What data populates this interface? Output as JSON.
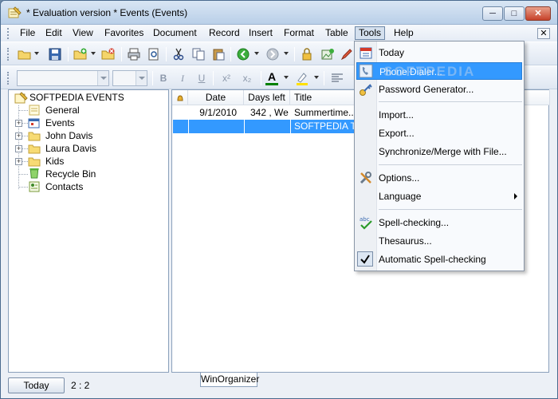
{
  "window": {
    "title": "* Evaluation version * Events (Events)",
    "min_label": "─",
    "max_label": "□",
    "close_label": "✕"
  },
  "menu": {
    "items": [
      "File",
      "Edit",
      "View",
      "Favorites",
      "Document",
      "Record",
      "Insert",
      "Format",
      "Table",
      "Tools",
      "Help"
    ],
    "active": "Tools",
    "close_label": "✕"
  },
  "format_toolbar": {
    "bold": "B",
    "italic": "I",
    "underline": "U",
    "superscript": "x²",
    "subscript": "x₂",
    "font_color_label": "A"
  },
  "tree": {
    "root": "SOFTPEDIA EVENTS",
    "items": [
      {
        "label": "General",
        "expandable": false,
        "icon": "note-icon"
      },
      {
        "label": "Events",
        "expandable": true,
        "icon": "calendar-icon"
      },
      {
        "label": "John Davis",
        "expandable": true,
        "icon": "folder-icon"
      },
      {
        "label": "Laura Davis",
        "expandable": true,
        "icon": "folder-icon"
      },
      {
        "label": "Kids",
        "expandable": true,
        "icon": "folder-icon"
      },
      {
        "label": "Recycle Bin",
        "expandable": false,
        "icon": "recycle-bin-icon"
      },
      {
        "label": "Contacts",
        "expandable": false,
        "icon": "contacts-icon"
      }
    ]
  },
  "list": {
    "columns": [
      "",
      "Date",
      "Days left",
      "Title"
    ],
    "rows": [
      {
        "date": "9/1/2010",
        "days_left": "342 , We",
        "title": "Summertime...is"
      },
      {
        "date": "",
        "days_left": "",
        "title": "SOFTPEDIA TE"
      }
    ],
    "selected_row": 1
  },
  "tabs": {
    "active": "WinOrganizer"
  },
  "status": {
    "today_button": "Today",
    "count": "2 : 2"
  },
  "tools_menu": {
    "items": [
      {
        "label": "Today",
        "icon": "calendar-today-icon"
      },
      {
        "label": "Phone Dialer...",
        "icon": "phone-icon",
        "highlighted": true
      },
      {
        "label": "Password Generator...",
        "icon": "key-icon"
      },
      {
        "label": "Import..."
      },
      {
        "label": "Export..."
      },
      {
        "label": "Synchronize/Merge with File..."
      },
      {
        "label": "Options...",
        "icon": "tools-icon"
      },
      {
        "label": "Language",
        "submenu": true
      },
      {
        "label": "Spell-checking...",
        "icon": "spellcheck-icon"
      },
      {
        "label": "Thesaurus..."
      },
      {
        "label": "Automatic Spell-checking",
        "checked": true
      }
    ]
  },
  "watermark": "SOFTPEDIA",
  "colors": {
    "selection": "#3399ff",
    "title_gradient_top": "#d9e6f4",
    "window_close": "#c6412a"
  }
}
